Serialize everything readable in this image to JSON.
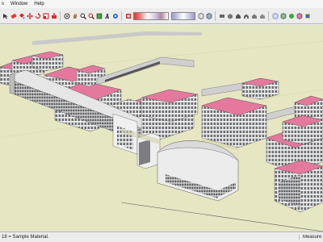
{
  "menubar": {
    "items": [
      "s",
      "Window",
      "Help"
    ]
  },
  "toolbar": {
    "tools": [
      "select-arrow-icon",
      "eraser-icon",
      "paint-bucket-icon",
      "move-icon",
      "rotate-icon",
      "scale-icon",
      "push-pull-icon",
      "orbit-icon",
      "pan-icon",
      "zoom-icon",
      "zoom-extents-icon",
      "section-icon",
      "walk-icon",
      "position-camera-icon",
      "style-icon",
      "hidden-line-icon",
      "shaded-icon",
      "top-view-icon",
      "iso-view-icon",
      "front-view-icon",
      "right-view-icon",
      "back-view-icon",
      "left-view-icon",
      "xray-icon",
      "component-icon",
      "material-icon",
      "layer-icon",
      "scene-icon"
    ]
  },
  "viewport": {
    "ground_color": "#e7e6c3",
    "roof_color": "#e4789d",
    "wall_color": "#ededec"
  },
  "statusbar": {
    "hint": "18 = Sample Material.",
    "measurements_label": "Measuremen"
  }
}
